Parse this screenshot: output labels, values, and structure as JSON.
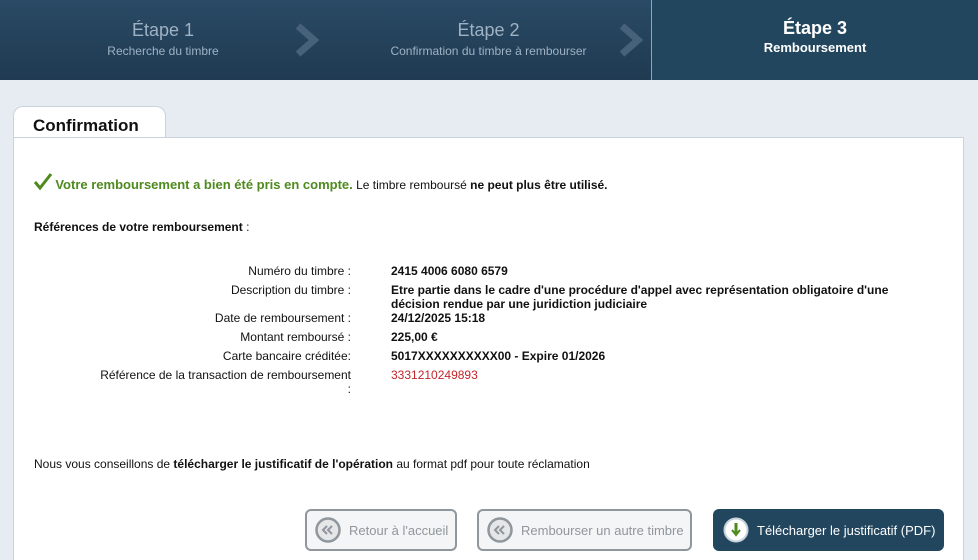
{
  "steps": [
    {
      "title": "Étape 1",
      "subtitle": "Recherche du timbre"
    },
    {
      "title": "Étape 2",
      "subtitle": "Confirmation du timbre à rembourser"
    },
    {
      "title": "Étape 3",
      "subtitle": "Remboursement"
    }
  ],
  "tab": {
    "label": "Confirmation"
  },
  "success": {
    "headline": "Votre remboursement a bien été pris en compte.",
    "text_before": " Le timbre remboursé ",
    "text_bold": "ne peut plus être utilisé."
  },
  "refs": {
    "title": "Références de votre remboursement",
    "suffix": " :"
  },
  "details": {
    "stamp_number_label": "Numéro du timbre :",
    "stamp_number": "2415 4006 6080 6579",
    "description_label": "Description du timbre :",
    "description_line1": "Etre partie dans le cadre d'une procédure d'appel avec représentation obligatoire d'une",
    "description_line2": "décision rendue par une juridiction judiciaire",
    "date_label": "Date de remboursement :",
    "date": "24/12/2025 15:18",
    "amount_label": "Montant remboursé :",
    "amount": "225,00 €",
    "card_label": "Carte bancaire créditée:",
    "card": "5017XXXXXXXXXX00 - Expire 01/2026",
    "transaction_label": "Référence de la transaction de remboursement",
    "transaction_label_colon": ":",
    "transaction": "3331210249893"
  },
  "advice": {
    "before": "Nous vous conseillons de ",
    "bold": "télécharger le justificatif de l'opération",
    "after": " au format pdf pour toute réclamation"
  },
  "buttons": {
    "home": "Retour à l'accueil",
    "other": "Rembourser un autre timbre",
    "download": "Télécharger le justificatif (PDF)"
  },
  "colors": {
    "header_bg": "#1d3a52",
    "active_step": "#23465f",
    "success_green": "#4e8a1e",
    "transaction_red": "#c0252b",
    "page_bg": "#e6ecf1"
  },
  "icons": {
    "step_separator": "chevron-right-icon",
    "success": "checkmark-icon",
    "back": "double-chevron-left-icon",
    "download": "download-arrow-icon"
  }
}
